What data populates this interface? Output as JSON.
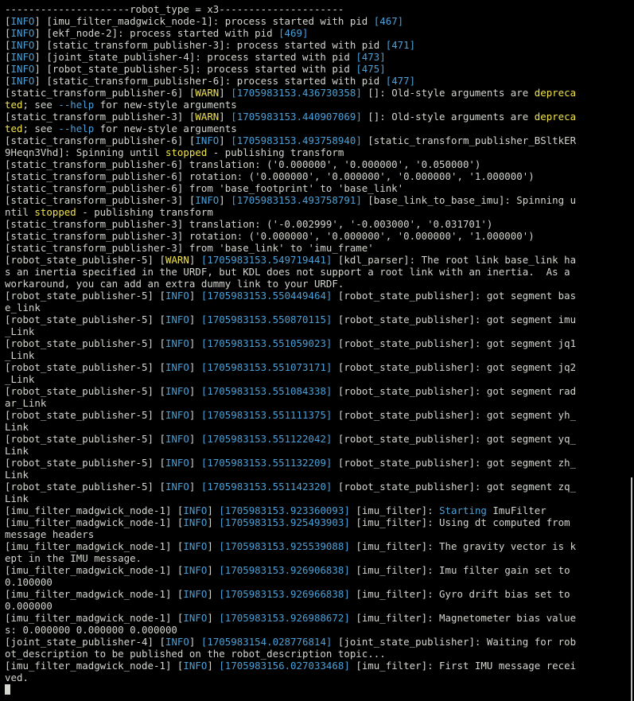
{
  "colors": {
    "background": "#000000",
    "text": "#d3d7cf",
    "info_tag": "#4aa0d8",
    "warn_tag": "#f2e44a",
    "timestamp": "#4aa0d8",
    "highlight": "#f2e44a"
  },
  "terminal": {
    "lines": [
      [
        {
          "t": "---------------------robot_type = x3---------------------"
        }
      ],
      [
        {
          "t": "["
        },
        {
          "t": "INFO",
          "c": "info"
        },
        {
          "t": "] [imu_filter_madgwick_node-1]: process started with pid "
        },
        {
          "t": "[467]",
          "c": "blu"
        }
      ],
      [
        {
          "t": "["
        },
        {
          "t": "INFO",
          "c": "info"
        },
        {
          "t": "] [ekf_node-2]: process started with pid "
        },
        {
          "t": "[469]",
          "c": "blu"
        }
      ],
      [
        {
          "t": "["
        },
        {
          "t": "INFO",
          "c": "info"
        },
        {
          "t": "] [static_transform_publisher-3]: process started with pid "
        },
        {
          "t": "[471]",
          "c": "blu"
        }
      ],
      [
        {
          "t": "["
        },
        {
          "t": "INFO",
          "c": "info"
        },
        {
          "t": "] [joint_state_publisher-4]: process started with pid "
        },
        {
          "t": "[473]",
          "c": "blu"
        }
      ],
      [
        {
          "t": "["
        },
        {
          "t": "INFO",
          "c": "info"
        },
        {
          "t": "] [robot_state_publisher-5]: process started with pid "
        },
        {
          "t": "[475]",
          "c": "blu"
        }
      ],
      [
        {
          "t": "["
        },
        {
          "t": "INFO",
          "c": "info"
        },
        {
          "t": "] [static_transform_publisher-6]: process started with pid "
        },
        {
          "t": "[477]",
          "c": "blu"
        }
      ],
      [
        {
          "t": "[static_transform_publisher-6] ["
        },
        {
          "t": "WARN",
          "c": "warn"
        },
        {
          "t": "] "
        },
        {
          "t": "[1705983153.436730358]",
          "c": "ts"
        },
        {
          "t": " []: Old-style arguments are "
        },
        {
          "t": "depreca",
          "c": "yel"
        }
      ],
      [
        {
          "t": "ted",
          "c": "yel"
        },
        {
          "t": "; see "
        },
        {
          "t": "--help",
          "c": "blu"
        },
        {
          "t": " for new-style arguments"
        }
      ],
      [
        {
          "t": "[static_transform_publisher-3] ["
        },
        {
          "t": "WARN",
          "c": "warn"
        },
        {
          "t": "] "
        },
        {
          "t": "[1705983153.440907069]",
          "c": "ts"
        },
        {
          "t": " []: Old-style arguments are "
        },
        {
          "t": "depreca",
          "c": "yel"
        }
      ],
      [
        {
          "t": "ted",
          "c": "yel"
        },
        {
          "t": "; see "
        },
        {
          "t": "--help",
          "c": "blu"
        },
        {
          "t": " for new-style arguments"
        }
      ],
      [
        {
          "t": "[static_transform_publisher-6] ["
        },
        {
          "t": "INFO",
          "c": "info"
        },
        {
          "t": "] "
        },
        {
          "t": "[1705983153.493758940]",
          "c": "ts"
        },
        {
          "t": " [static_transform_publisher_BSltkER"
        }
      ],
      [
        {
          "t": "9Heqn3Vhd]: Spinning until "
        },
        {
          "t": "stopped",
          "c": "yel"
        },
        {
          "t": " - publishing transform"
        }
      ],
      [
        {
          "t": "[static_transform_publisher-6] translation: ('0.000000', '0.000000', '0.050000')"
        }
      ],
      [
        {
          "t": "[static_transform_publisher-6] rotation: ('0.000000', '0.000000', '0.000000', '1.000000')"
        }
      ],
      [
        {
          "t": "[static_transform_publisher-6] from 'base_footprint' to 'base_link'"
        }
      ],
      [
        {
          "t": "[static_transform_publisher-3] ["
        },
        {
          "t": "INFO",
          "c": "info"
        },
        {
          "t": "] "
        },
        {
          "t": "[1705983153.493758791]",
          "c": "ts"
        },
        {
          "t": " [base_link_to_base_imu]: Spinning u"
        }
      ],
      [
        {
          "t": "ntil "
        },
        {
          "t": "stopped",
          "c": "yel"
        },
        {
          "t": " - publishing transform"
        }
      ],
      [
        {
          "t": "[static_transform_publisher-3] translation: ('-0.002999', '-0.003000', '0.031701')"
        }
      ],
      [
        {
          "t": "[static_transform_publisher-3] rotation: ('0.000000', '0.000000', '0.000000', '1.000000')"
        }
      ],
      [
        {
          "t": "[static_transform_publisher-3] from 'base_link' to 'imu_frame'"
        }
      ],
      [
        {
          "t": "[robot_state_publisher-5] ["
        },
        {
          "t": "WARN",
          "c": "warn"
        },
        {
          "t": "] "
        },
        {
          "t": "[1705983153.549719441]",
          "c": "ts"
        },
        {
          "t": " [kdl_parser]: The root link base_link ha"
        }
      ],
      [
        {
          "t": "s an inertia specified in the URDF, but KDL does not support a root link with an inertia.  As a"
        }
      ],
      [
        {
          "t": "workaround, you can add an extra dummy link to your URDF."
        }
      ],
      [
        {
          "t": "[robot_state_publisher-5] ["
        },
        {
          "t": "INFO",
          "c": "info"
        },
        {
          "t": "] "
        },
        {
          "t": "[1705983153.550449464]",
          "c": "ts"
        },
        {
          "t": " [robot_state_publisher]: got segment bas"
        }
      ],
      [
        {
          "t": "e_link"
        }
      ],
      [
        {
          "t": "[robot_state_publisher-5] ["
        },
        {
          "t": "INFO",
          "c": "info"
        },
        {
          "t": "] "
        },
        {
          "t": "[1705983153.550870115]",
          "c": "ts"
        },
        {
          "t": " [robot_state_publisher]: got segment imu"
        }
      ],
      [
        {
          "t": "_Link"
        }
      ],
      [
        {
          "t": "[robot_state_publisher-5] ["
        },
        {
          "t": "INFO",
          "c": "info"
        },
        {
          "t": "] "
        },
        {
          "t": "[1705983153.551059023]",
          "c": "ts"
        },
        {
          "t": " [robot_state_publisher]: got segment jq1"
        }
      ],
      [
        {
          "t": "_Link"
        }
      ],
      [
        {
          "t": "[robot_state_publisher-5] ["
        },
        {
          "t": "INFO",
          "c": "info"
        },
        {
          "t": "] "
        },
        {
          "t": "[1705983153.551073171]",
          "c": "ts"
        },
        {
          "t": " [robot_state_publisher]: got segment jq2"
        }
      ],
      [
        {
          "t": "_Link"
        }
      ],
      [
        {
          "t": "[robot_state_publisher-5] ["
        },
        {
          "t": "INFO",
          "c": "info"
        },
        {
          "t": "] "
        },
        {
          "t": "[1705983153.551084338]",
          "c": "ts"
        },
        {
          "t": " [robot_state_publisher]: got segment rad"
        }
      ],
      [
        {
          "t": "ar_Link"
        }
      ],
      [
        {
          "t": "[robot_state_publisher-5] ["
        },
        {
          "t": "INFO",
          "c": "info"
        },
        {
          "t": "] "
        },
        {
          "t": "[1705983153.551111375]",
          "c": "ts"
        },
        {
          "t": " [robot_state_publisher]: got segment yh_"
        }
      ],
      [
        {
          "t": "Link"
        }
      ],
      [
        {
          "t": "[robot_state_publisher-5] ["
        },
        {
          "t": "INFO",
          "c": "info"
        },
        {
          "t": "] "
        },
        {
          "t": "[1705983153.551122042]",
          "c": "ts"
        },
        {
          "t": " [robot_state_publisher]: got segment yq_"
        }
      ],
      [
        {
          "t": "Link"
        }
      ],
      [
        {
          "t": "[robot_state_publisher-5] ["
        },
        {
          "t": "INFO",
          "c": "info"
        },
        {
          "t": "] "
        },
        {
          "t": "[1705983153.551132209]",
          "c": "ts"
        },
        {
          "t": " [robot_state_publisher]: got segment zh_"
        }
      ],
      [
        {
          "t": "Link"
        }
      ],
      [
        {
          "t": "[robot_state_publisher-5] ["
        },
        {
          "t": "INFO",
          "c": "info"
        },
        {
          "t": "] "
        },
        {
          "t": "[1705983153.551142320]",
          "c": "ts"
        },
        {
          "t": " [robot_state_publisher]: got segment zq_"
        }
      ],
      [
        {
          "t": "Link"
        }
      ],
      [
        {
          "t": "[imu_filter_madgwick_node-1] ["
        },
        {
          "t": "INFO",
          "c": "info"
        },
        {
          "t": "] "
        },
        {
          "t": "[1705983153.923360093]",
          "c": "ts"
        },
        {
          "t": " [imu_filter]: "
        },
        {
          "t": "Starting",
          "c": "blu"
        },
        {
          "t": " ImuFilter"
        }
      ],
      [
        {
          "t": "[imu_filter_madgwick_node-1] ["
        },
        {
          "t": "INFO",
          "c": "info"
        },
        {
          "t": "] "
        },
        {
          "t": "[1705983153.925493903]",
          "c": "ts"
        },
        {
          "t": " [imu_filter]: Using dt computed from"
        }
      ],
      [
        {
          "t": "message headers"
        }
      ],
      [
        {
          "t": "[imu_filter_madgwick_node-1] ["
        },
        {
          "t": "INFO",
          "c": "info"
        },
        {
          "t": "] "
        },
        {
          "t": "[1705983153.925539088]",
          "c": "ts"
        },
        {
          "t": " [imu_filter]: The gravity vector is k"
        }
      ],
      [
        {
          "t": "ept in the IMU message."
        }
      ],
      [
        {
          "t": "[imu_filter_madgwick_node-1] ["
        },
        {
          "t": "INFO",
          "c": "info"
        },
        {
          "t": "] "
        },
        {
          "t": "[1705983153.926906838]",
          "c": "ts"
        },
        {
          "t": " [imu_filter]: Imu filter gain set to"
        }
      ],
      [
        {
          "t": "0.100000"
        }
      ],
      [
        {
          "t": "[imu_filter_madgwick_node-1] ["
        },
        {
          "t": "INFO",
          "c": "info"
        },
        {
          "t": "] "
        },
        {
          "t": "[1705983153.926966838]",
          "c": "ts"
        },
        {
          "t": " [imu_filter]: Gyro drift bias set to"
        }
      ],
      [
        {
          "t": "0.000000"
        }
      ],
      [
        {
          "t": "[imu_filter_madgwick_node-1] ["
        },
        {
          "t": "INFO",
          "c": "info"
        },
        {
          "t": "] "
        },
        {
          "t": "[1705983153.926988672]",
          "c": "ts"
        },
        {
          "t": " [imu_filter]: Magnetometer bias value"
        }
      ],
      [
        {
          "t": "s: 0.000000 0.000000 0.000000"
        }
      ],
      [
        {
          "t": "[joint_state_publisher-4] ["
        },
        {
          "t": "INFO",
          "c": "info"
        },
        {
          "t": "] "
        },
        {
          "t": "[1705983154.028776814]",
          "c": "ts"
        },
        {
          "t": " [joint_state_publisher]: Waiting for rob"
        }
      ],
      [
        {
          "t": "ot_description to be published on the robot_description topic..."
        }
      ],
      [
        {
          "t": "[imu_filter_madgwick_node-1] ["
        },
        {
          "t": "INFO",
          "c": "info"
        },
        {
          "t": "] "
        },
        {
          "t": "[1705983156.027033468]",
          "c": "ts"
        },
        {
          "t": " [imu_filter]: First IMU message recei"
        }
      ],
      [
        {
          "t": "ved."
        }
      ]
    ]
  }
}
